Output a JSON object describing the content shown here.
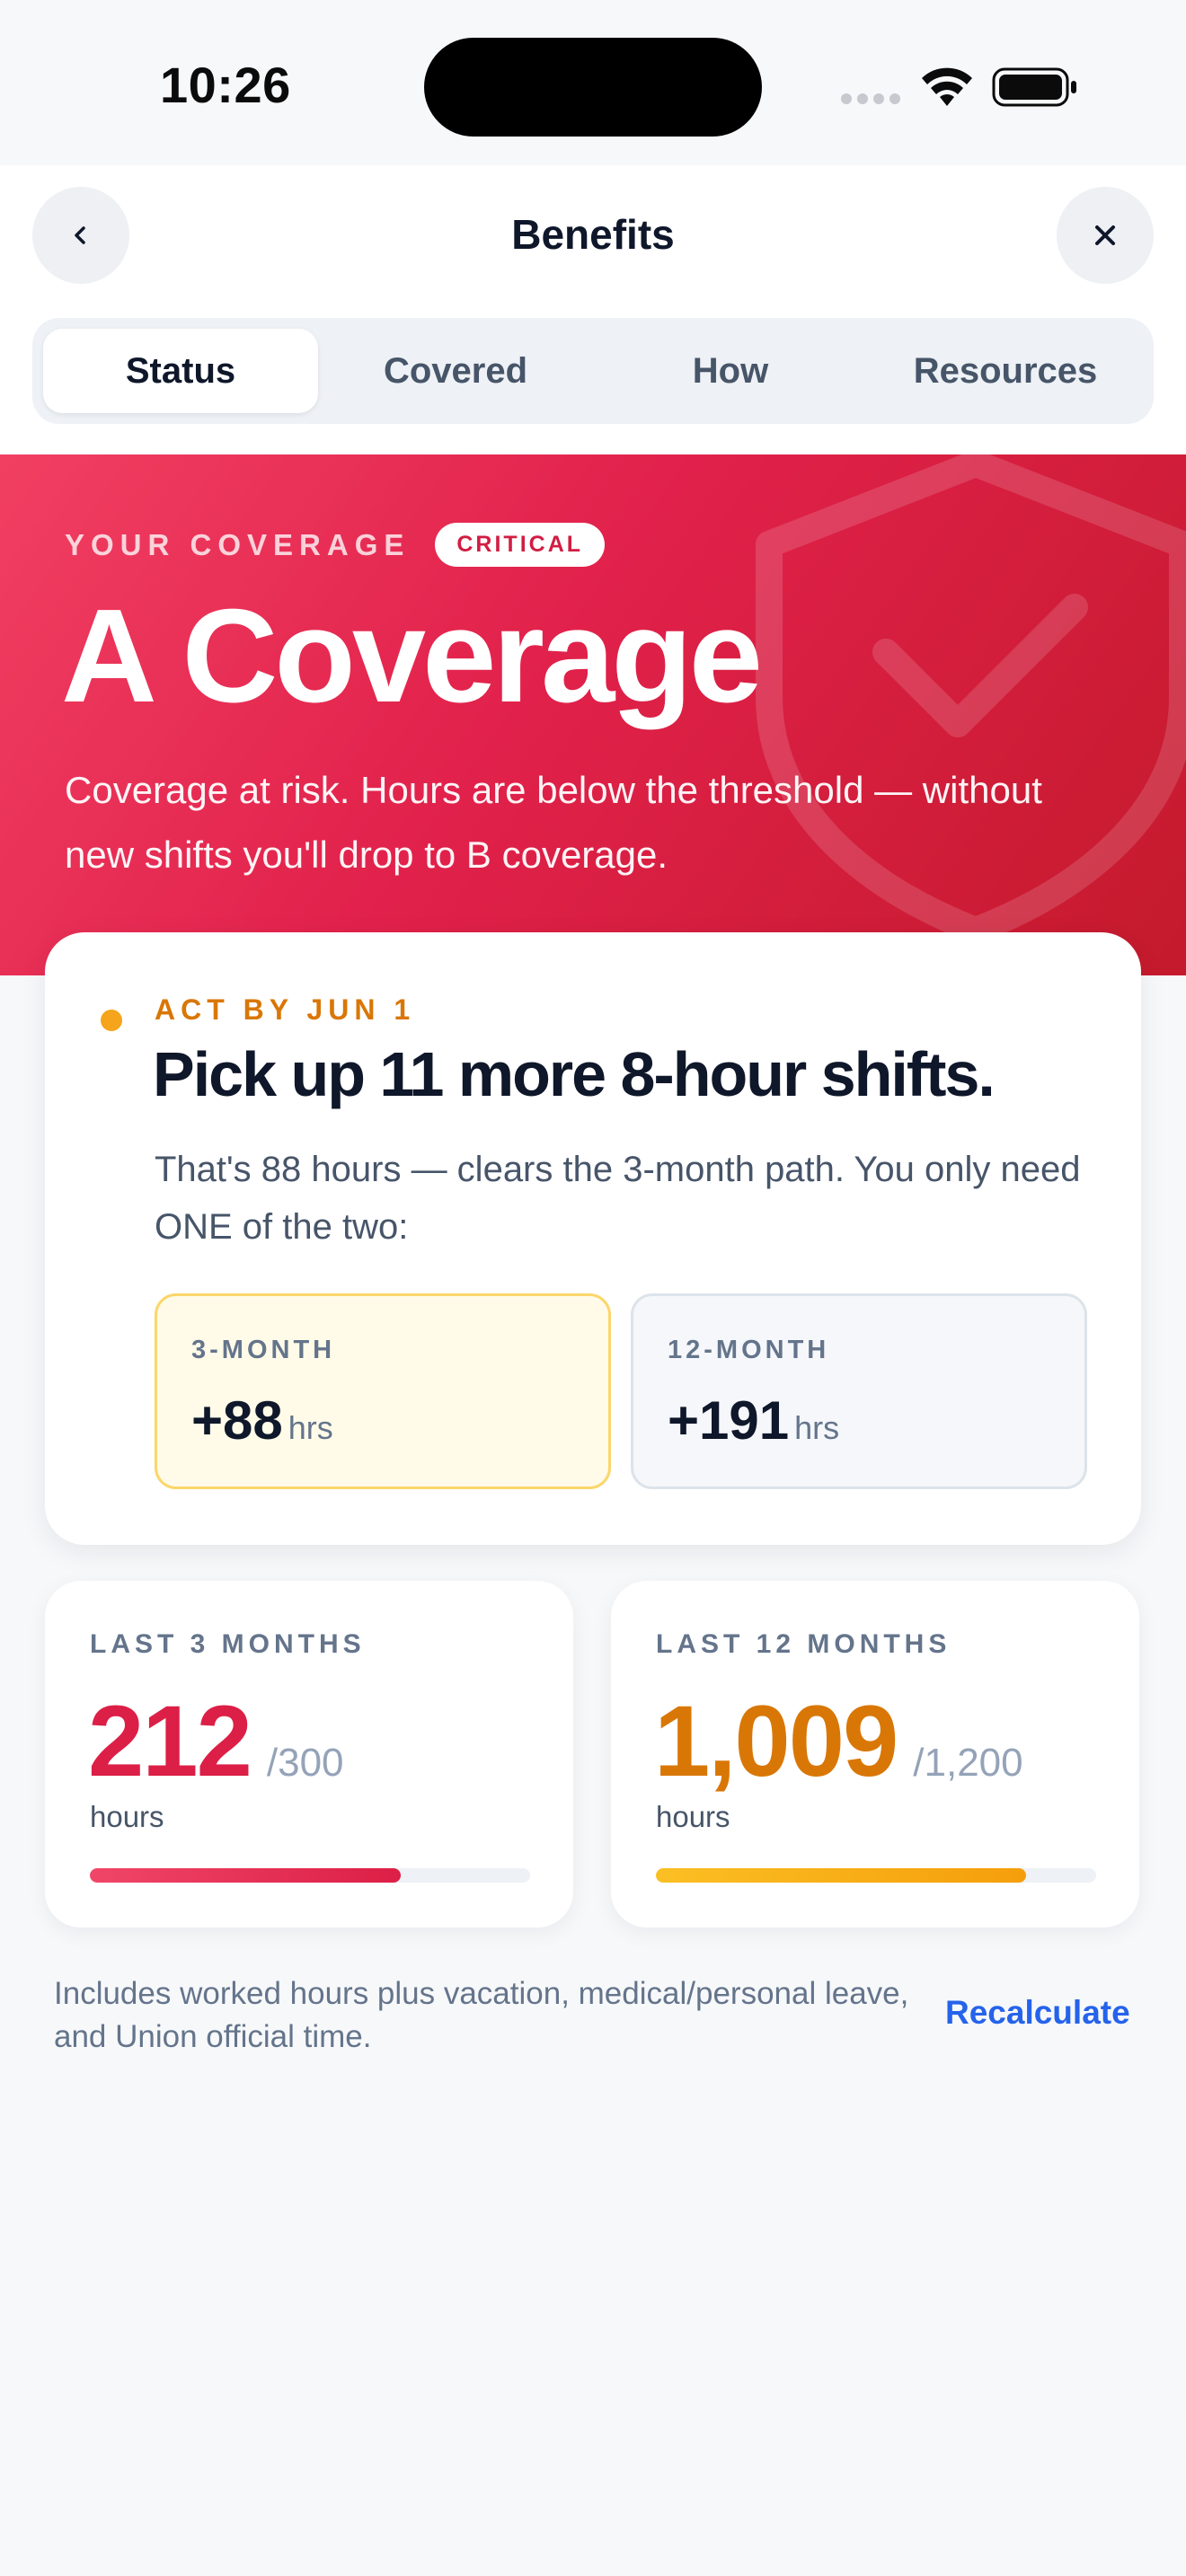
{
  "status_bar": {
    "time": "10:26"
  },
  "header": {
    "title": "Benefits"
  },
  "tabs": [
    {
      "label": "Status",
      "active": true
    },
    {
      "label": "Covered",
      "active": false
    },
    {
      "label": "How",
      "active": false
    },
    {
      "label": "Resources",
      "active": false
    }
  ],
  "hero": {
    "eyebrow": "YOUR COVERAGE",
    "badge": "CRITICAL",
    "title": "A Coverage",
    "description": "Coverage at risk. Hours are below the threshold — without new shifts you'll drop to B coverage."
  },
  "action": {
    "deadline": "ACT BY JUN 1",
    "title": "Pick up 11 more 8-hour shifts.",
    "description": "That's 88 hours — clears the 3-month path. You only need ONE of the two:",
    "paths": [
      {
        "label": "3-MONTH",
        "value": "+88",
        "unit": "hrs"
      },
      {
        "label": "12-MONTH",
        "value": "+191",
        "unit": "hrs"
      }
    ]
  },
  "stats": [
    {
      "label": "LAST 3 MONTHS",
      "value": "212",
      "max": "/300",
      "unit": "hours",
      "progress": 0.707
    },
    {
      "label": "LAST 12 MONTHS",
      "value": "1,009",
      "max": "/1,200",
      "unit": "hours",
      "progress": 0.841
    }
  ],
  "footer": {
    "note": "Includes worked hours plus vacation, medical/personal leave, and Union official time.",
    "recalculate_label": "Recalculate"
  },
  "colors": {
    "critical": "#dc1f46",
    "warning": "#d97706",
    "link": "#2563eb"
  }
}
